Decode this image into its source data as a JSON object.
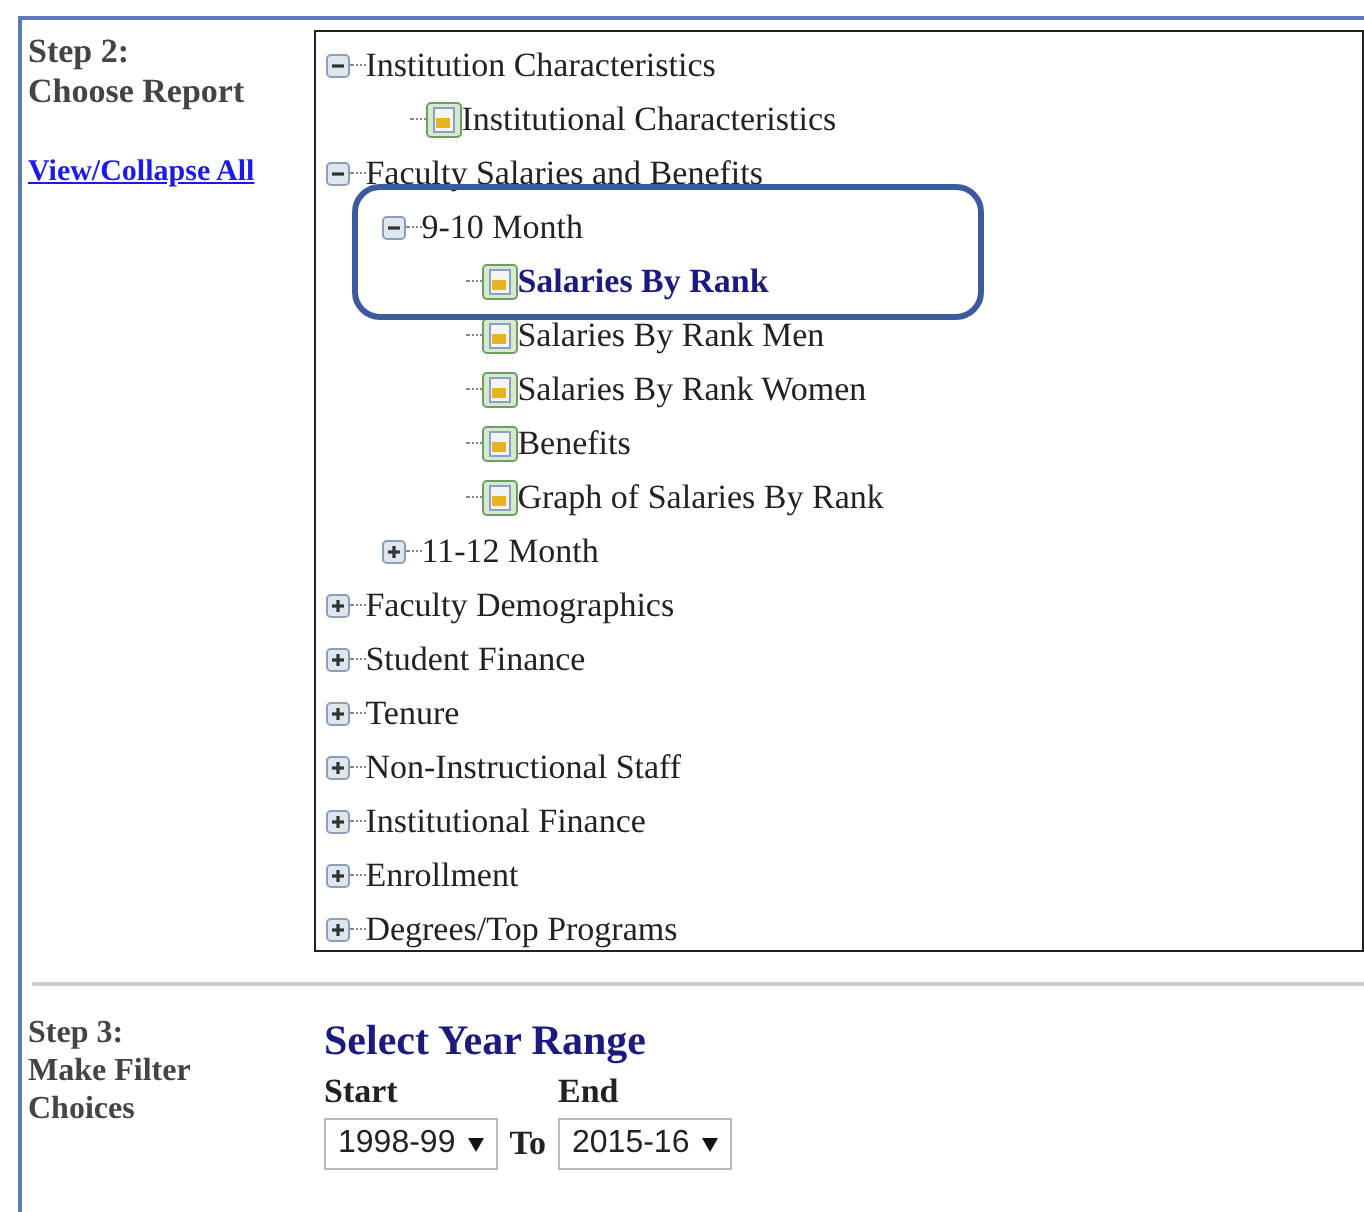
{
  "step2": {
    "heading": "Step 2:",
    "subheading": "Choose Report",
    "link": "View/Collapse All"
  },
  "tree": [
    {
      "kind": "folder",
      "label": "Institution Characteristics",
      "expanded": true,
      "children": [
        {
          "kind": "report",
          "label": "Institutional Characteristics",
          "selected": false
        }
      ]
    },
    {
      "kind": "folder",
      "label": "Faculty Salaries and Benefits",
      "expanded": true,
      "children": [
        {
          "kind": "folder",
          "label": "9-10 Month",
          "expanded": true,
          "children": [
            {
              "kind": "report",
              "label": "Salaries By Rank",
              "selected": true
            },
            {
              "kind": "report",
              "label": "Salaries By Rank Men",
              "selected": false
            },
            {
              "kind": "report",
              "label": "Salaries By Rank Women",
              "selected": false
            },
            {
              "kind": "report",
              "label": "Benefits",
              "selected": false
            },
            {
              "kind": "report",
              "label": "Graph of Salaries By Rank",
              "selected": false
            }
          ]
        },
        {
          "kind": "folder",
          "label": "11-12 Month",
          "expanded": false
        }
      ]
    },
    {
      "kind": "folder",
      "label": "Faculty Demographics",
      "expanded": false
    },
    {
      "kind": "folder",
      "label": "Student Finance",
      "expanded": false
    },
    {
      "kind": "folder",
      "label": "Tenure",
      "expanded": false
    },
    {
      "kind": "folder",
      "label": "Non-Instructional Staff",
      "expanded": false
    },
    {
      "kind": "folder",
      "label": "Institutional Finance",
      "expanded": false
    },
    {
      "kind": "folder",
      "label": "Enrollment",
      "expanded": false
    },
    {
      "kind": "folder",
      "label": "Degrees/Top Programs",
      "expanded": false
    }
  ],
  "step3": {
    "heading": "Step 3:",
    "subheading": "Make Filter Choices",
    "title": "Select Year Range",
    "start_label": "Start",
    "start_value": "1998-99",
    "to": "To",
    "end_label": "End",
    "end_value": "2015-16"
  }
}
